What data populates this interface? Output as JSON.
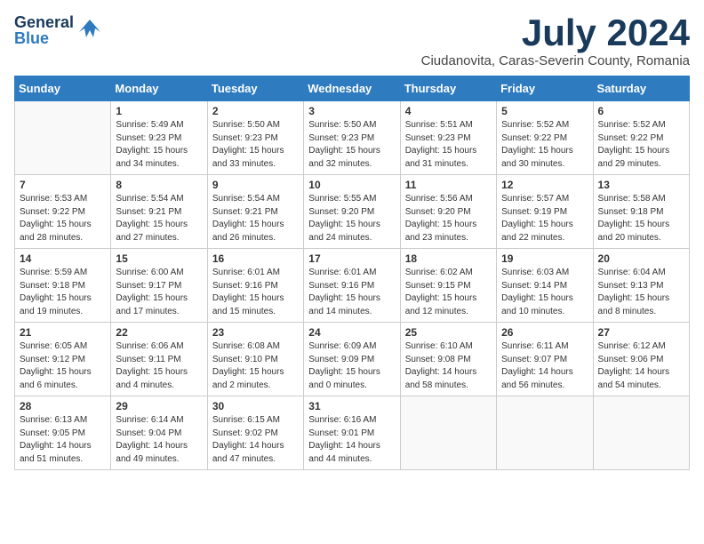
{
  "logo": {
    "line1": "General",
    "line2": "Blue"
  },
  "title": "July 2024",
  "location": "Ciudanovita, Caras-Severin County, Romania",
  "days_of_week": [
    "Sunday",
    "Monday",
    "Tuesday",
    "Wednesday",
    "Thursday",
    "Friday",
    "Saturday"
  ],
  "weeks": [
    [
      {
        "day": "",
        "content": ""
      },
      {
        "day": "1",
        "content": "Sunrise: 5:49 AM\nSunset: 9:23 PM\nDaylight: 15 hours\nand 34 minutes."
      },
      {
        "day": "2",
        "content": "Sunrise: 5:50 AM\nSunset: 9:23 PM\nDaylight: 15 hours\nand 33 minutes."
      },
      {
        "day": "3",
        "content": "Sunrise: 5:50 AM\nSunset: 9:23 PM\nDaylight: 15 hours\nand 32 minutes."
      },
      {
        "day": "4",
        "content": "Sunrise: 5:51 AM\nSunset: 9:23 PM\nDaylight: 15 hours\nand 31 minutes."
      },
      {
        "day": "5",
        "content": "Sunrise: 5:52 AM\nSunset: 9:22 PM\nDaylight: 15 hours\nand 30 minutes."
      },
      {
        "day": "6",
        "content": "Sunrise: 5:52 AM\nSunset: 9:22 PM\nDaylight: 15 hours\nand 29 minutes."
      }
    ],
    [
      {
        "day": "7",
        "content": "Sunrise: 5:53 AM\nSunset: 9:22 PM\nDaylight: 15 hours\nand 28 minutes."
      },
      {
        "day": "8",
        "content": "Sunrise: 5:54 AM\nSunset: 9:21 PM\nDaylight: 15 hours\nand 27 minutes."
      },
      {
        "day": "9",
        "content": "Sunrise: 5:54 AM\nSunset: 9:21 PM\nDaylight: 15 hours\nand 26 minutes."
      },
      {
        "day": "10",
        "content": "Sunrise: 5:55 AM\nSunset: 9:20 PM\nDaylight: 15 hours\nand 24 minutes."
      },
      {
        "day": "11",
        "content": "Sunrise: 5:56 AM\nSunset: 9:20 PM\nDaylight: 15 hours\nand 23 minutes."
      },
      {
        "day": "12",
        "content": "Sunrise: 5:57 AM\nSunset: 9:19 PM\nDaylight: 15 hours\nand 22 minutes."
      },
      {
        "day": "13",
        "content": "Sunrise: 5:58 AM\nSunset: 9:18 PM\nDaylight: 15 hours\nand 20 minutes."
      }
    ],
    [
      {
        "day": "14",
        "content": "Sunrise: 5:59 AM\nSunset: 9:18 PM\nDaylight: 15 hours\nand 19 minutes."
      },
      {
        "day": "15",
        "content": "Sunrise: 6:00 AM\nSunset: 9:17 PM\nDaylight: 15 hours\nand 17 minutes."
      },
      {
        "day": "16",
        "content": "Sunrise: 6:01 AM\nSunset: 9:16 PM\nDaylight: 15 hours\nand 15 minutes."
      },
      {
        "day": "17",
        "content": "Sunrise: 6:01 AM\nSunset: 9:16 PM\nDaylight: 15 hours\nand 14 minutes."
      },
      {
        "day": "18",
        "content": "Sunrise: 6:02 AM\nSunset: 9:15 PM\nDaylight: 15 hours\nand 12 minutes."
      },
      {
        "day": "19",
        "content": "Sunrise: 6:03 AM\nSunset: 9:14 PM\nDaylight: 15 hours\nand 10 minutes."
      },
      {
        "day": "20",
        "content": "Sunrise: 6:04 AM\nSunset: 9:13 PM\nDaylight: 15 hours\nand 8 minutes."
      }
    ],
    [
      {
        "day": "21",
        "content": "Sunrise: 6:05 AM\nSunset: 9:12 PM\nDaylight: 15 hours\nand 6 minutes."
      },
      {
        "day": "22",
        "content": "Sunrise: 6:06 AM\nSunset: 9:11 PM\nDaylight: 15 hours\nand 4 minutes."
      },
      {
        "day": "23",
        "content": "Sunrise: 6:08 AM\nSunset: 9:10 PM\nDaylight: 15 hours\nand 2 minutes."
      },
      {
        "day": "24",
        "content": "Sunrise: 6:09 AM\nSunset: 9:09 PM\nDaylight: 15 hours\nand 0 minutes."
      },
      {
        "day": "25",
        "content": "Sunrise: 6:10 AM\nSunset: 9:08 PM\nDaylight: 14 hours\nand 58 minutes."
      },
      {
        "day": "26",
        "content": "Sunrise: 6:11 AM\nSunset: 9:07 PM\nDaylight: 14 hours\nand 56 minutes."
      },
      {
        "day": "27",
        "content": "Sunrise: 6:12 AM\nSunset: 9:06 PM\nDaylight: 14 hours\nand 54 minutes."
      }
    ],
    [
      {
        "day": "28",
        "content": "Sunrise: 6:13 AM\nSunset: 9:05 PM\nDaylight: 14 hours\nand 51 minutes."
      },
      {
        "day": "29",
        "content": "Sunrise: 6:14 AM\nSunset: 9:04 PM\nDaylight: 14 hours\nand 49 minutes."
      },
      {
        "day": "30",
        "content": "Sunrise: 6:15 AM\nSunset: 9:02 PM\nDaylight: 14 hours\nand 47 minutes."
      },
      {
        "day": "31",
        "content": "Sunrise: 6:16 AM\nSunset: 9:01 PM\nDaylight: 14 hours\nand 44 minutes."
      },
      {
        "day": "",
        "content": ""
      },
      {
        "day": "",
        "content": ""
      },
      {
        "day": "",
        "content": ""
      }
    ]
  ]
}
